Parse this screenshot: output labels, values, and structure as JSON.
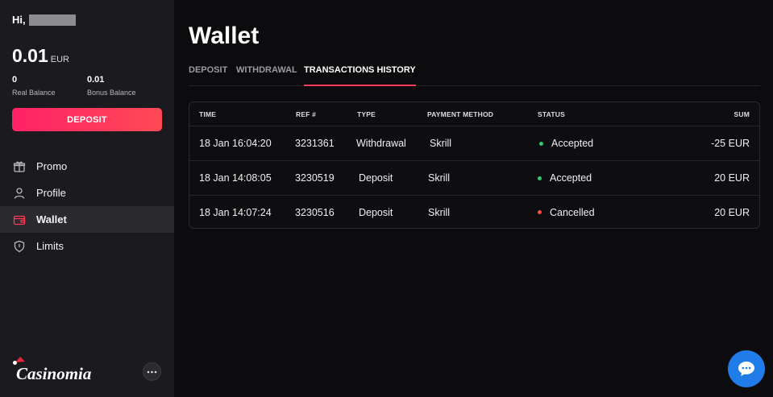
{
  "user": {
    "greeting": "Hi,"
  },
  "balance": {
    "amount": "0.01",
    "currency": "EUR",
    "real_value": "0",
    "real_label": "Real Balance",
    "bonus_value": "0.01",
    "bonus_label": "Bonus Balance"
  },
  "sidebar": {
    "deposit_label": "DEPOSIT",
    "items": [
      {
        "label": "Promo",
        "icon": "gift-icon"
      },
      {
        "label": "Profile",
        "icon": "user-icon"
      },
      {
        "label": "Wallet",
        "icon": "wallet-icon",
        "active": true
      },
      {
        "label": "Limits",
        "icon": "shield-icon"
      }
    ],
    "brand": "Casinomia"
  },
  "main": {
    "title": "Wallet",
    "tabs": [
      {
        "label": "DEPOSIT"
      },
      {
        "label": "WITHDRAWAL"
      },
      {
        "label": "TRANSACTIONS HISTORY",
        "active": true
      }
    ],
    "table": {
      "headers": [
        "TIME",
        "REF #",
        "TYPE",
        "PAYMENT METHOD",
        "STATUS",
        "SUM"
      ],
      "rows": [
        {
          "time": "18 Jan 16:04:20",
          "ref": "3231361",
          "type": "Withdrawal",
          "method": "Skrill",
          "status": "Accepted",
          "status_color": "#2ecc71",
          "sum": "-25 EUR"
        },
        {
          "time": "18 Jan 14:08:05",
          "ref": "3230519",
          "type": "Deposit",
          "method": "Skrill",
          "status": "Accepted",
          "status_color": "#2ecc71",
          "sum": "20 EUR"
        },
        {
          "time": "18 Jan 14:07:24",
          "ref": "3230516",
          "type": "Deposit",
          "method": "Skrill",
          "status": "Cancelled",
          "status_color": "#ff4a3d",
          "sum": "20 EUR"
        }
      ]
    }
  },
  "colors": {
    "accent": "#ff2e5f",
    "chat": "#1f7ce8",
    "sidebar_bg": "#1b1b1f",
    "page_bg": "#0c0c0e"
  },
  "chat": {
    "icon": "chat-bubble-icon"
  }
}
